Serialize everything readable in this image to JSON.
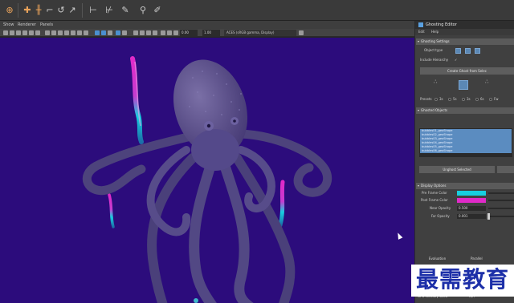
{
  "viewport_menu": {
    "show": "Show",
    "renderer": "Renderer",
    "panels": "Panels"
  },
  "viewport_toolbar": {
    "field_a": "0.00",
    "field_b": "1.00",
    "camera": "ACES (sRGB gamma, Display)"
  },
  "ghosting_editor": {
    "title": "Ghosting Editor",
    "menu": {
      "edit": "Edit",
      "help": "Help"
    },
    "settings_header": "Ghosting Settings",
    "object_type_label": "Object type",
    "include_hierarchy_label": "Include Hierarchy",
    "create_ghost_button": "Create Ghost from Selec",
    "presets_label": "Presets",
    "preset_options": [
      "3s",
      "5s",
      "3s",
      "6s",
      "Fw"
    ],
    "ghosted_objects_header": "Ghosted Objects",
    "ghosted_objects": [
      "bubbles01_geoShape",
      "bubbles02_geoShape",
      "bubbles03_geoShape",
      "bubbles04_geoShape",
      "bubbles05_geoShape",
      "bubbles06_geoShape"
    ],
    "unghost_selected_button": "Unghost Selected",
    "display_options_header": "Display Options",
    "pre_frame_color_label": "Pre Frame Color",
    "post_frame_color_label": "Post Frame Color",
    "near_opacity_label": "Near Opacity",
    "near_opacity_value": "0.500",
    "far_opacity_label": "Far Opacity",
    "far_opacity_value": "0.001",
    "pre_frame_color": "#17cfe0",
    "post_frame_color": "#e02ac8"
  },
  "hud": {
    "evaluation_label": "Evaluation",
    "evaluation_value": "Parallel",
    "gpu_memory_label": "GPU Memory Used",
    "gpu_memory_value": "N/A"
  },
  "watermark": "最需教育",
  "colors": {
    "viewport_bg": "#2c0c7c",
    "octopus": "#5a4f86",
    "accent_blue": "#5b8cc0"
  }
}
